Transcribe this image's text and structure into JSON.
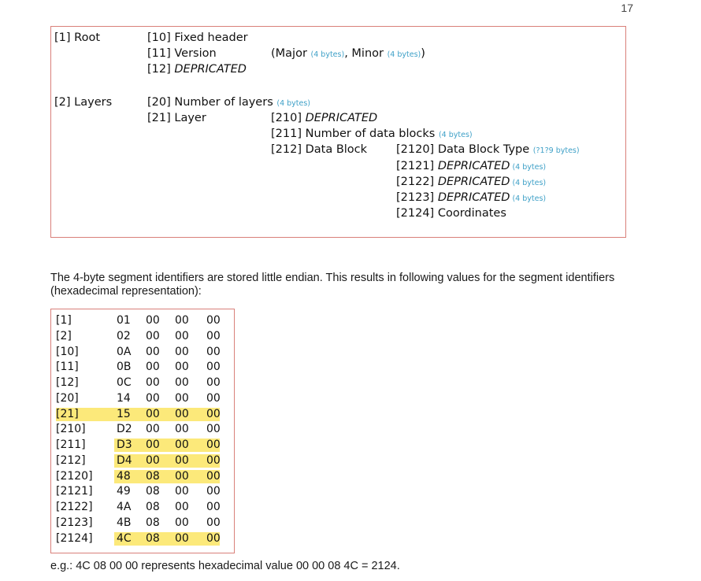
{
  "page_number": "17",
  "structure": {
    "root_label": "[1] Root",
    "fixed_header": "[10] Fixed header",
    "version": "[11] Version",
    "version_detail_open": "(Major ",
    "version_major_size": "(4 bytes)",
    "version_detail_mid": ", Minor ",
    "version_minor_size": "(4 bytes)",
    "version_detail_close": ")",
    "r12_id": "[12] ",
    "r12_text": "DEPRICATED",
    "layers_label": "[2] Layers",
    "num_layers": "[20] Number of layers ",
    "num_layers_size": "(4 bytes)",
    "layer": "[21] Layer",
    "r210_id": "[210] ",
    "r210_text": "DEPRICATED",
    "num_blocks": "[211] Number of data blocks ",
    "num_blocks_size": "(4 bytes)",
    "data_block": "[212] Data Block",
    "block_type": "[2120] Data Block Type ",
    "block_type_size": "(?1?9 bytes)",
    "r2121_id": "[2121] ",
    "r2121_text": "DEPRICATED",
    "r2121_size": " (4 bytes)",
    "r2122_id": "[2122] ",
    "r2122_text": "DEPRICATED",
    "r2122_size": " (4 bytes)",
    "r2123_id": "[2123] ",
    "r2123_text": "DEPRICATED",
    "r2123_size": " (4 bytes)",
    "coordinates": "[2124] Coordinates"
  },
  "paragraph": "The 4-byte segment identifiers are stored little endian. This results in following values for the segment identifiers (hexadecimal representation):",
  "hex_table": [
    {
      "id": "[1]",
      "b": [
        "01",
        "00",
        "00",
        "00"
      ],
      "highlight": "none"
    },
    {
      "id": "[2]",
      "b": [
        "02",
        "00",
        "00",
        "00"
      ],
      "highlight": "none"
    },
    {
      "id": "[10]",
      "b": [
        "0A",
        "00",
        "00",
        "00"
      ],
      "highlight": "none"
    },
    {
      "id": "[11]",
      "b": [
        "0B",
        "00",
        "00",
        "00"
      ],
      "highlight": "none"
    },
    {
      "id": "[12]",
      "b": [
        "0C",
        "00",
        "00",
        "00"
      ],
      "highlight": "none"
    },
    {
      "id": "[20]",
      "b": [
        "14",
        "00",
        "00",
        "00"
      ],
      "highlight": "none"
    },
    {
      "id": "[21]",
      "b": [
        "15",
        "00",
        "00",
        "00"
      ],
      "highlight": "full"
    },
    {
      "id": "[210]",
      "b": [
        "D2",
        "00",
        "00",
        "00"
      ],
      "highlight": "none"
    },
    {
      "id": "[211]",
      "b": [
        "D3",
        "00",
        "00",
        "00"
      ],
      "highlight": "bytes"
    },
    {
      "id": "[212]",
      "b": [
        "D4",
        "00",
        "00",
        "00"
      ],
      "highlight": "bytes"
    },
    {
      "id": "[2120]",
      "b": [
        "48",
        "08",
        "00",
        "00"
      ],
      "highlight": "bytes"
    },
    {
      "id": "[2121]",
      "b": [
        "49",
        "08",
        "00",
        "00"
      ],
      "highlight": "none"
    },
    {
      "id": "[2122]",
      "b": [
        "4A",
        "08",
        "00",
        "00"
      ],
      "highlight": "none"
    },
    {
      "id": "[2123]",
      "b": [
        "4B",
        "08",
        "00",
        "00"
      ],
      "highlight": "none"
    },
    {
      "id": "[2124]",
      "b": [
        "4C",
        "08",
        "00",
        "00"
      ],
      "highlight": "bytes"
    }
  ],
  "highlight_color": "#fce97a",
  "footer": "e.g.: 4C 08 00 00 represents hexadecimal value 00 00 08 4C = 2124."
}
